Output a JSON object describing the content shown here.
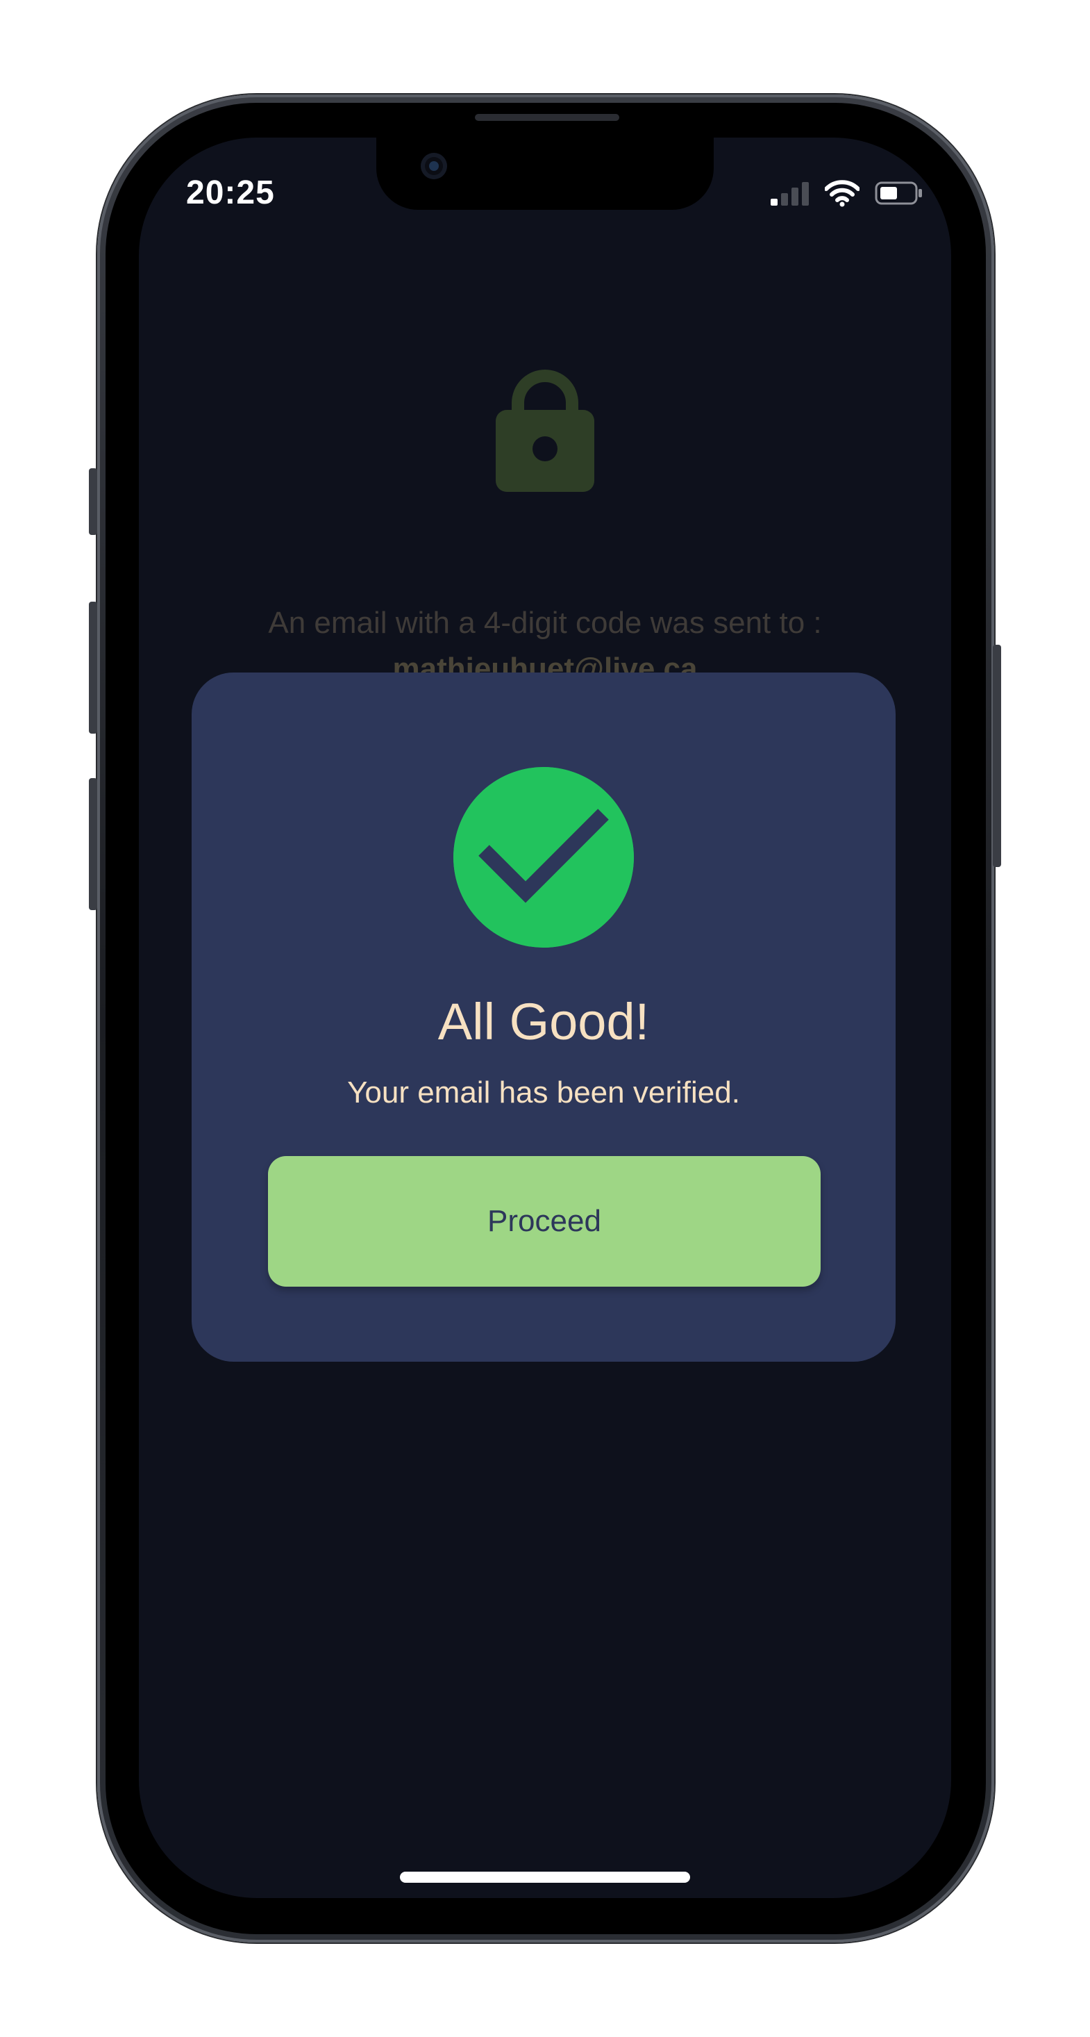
{
  "status_bar": {
    "time": "20:25",
    "icons": [
      "cellular-signal-icon",
      "wifi-icon",
      "battery-icon"
    ]
  },
  "background": {
    "icon": "lock-icon",
    "message": "An email with a 4-digit code was sent to :",
    "email": "mathieuhuet@live.ca"
  },
  "modal": {
    "icon": "checkmark-circle-icon",
    "title": "All Good!",
    "subtitle": "Your email has been verified.",
    "button_label": "Proceed"
  },
  "colors": {
    "screen_bg": "#0e111c",
    "modal_bg": "#2d375a",
    "success_green": "#22c35d",
    "button_green": "#9ed685",
    "text_cream": "#f7e1c2"
  }
}
